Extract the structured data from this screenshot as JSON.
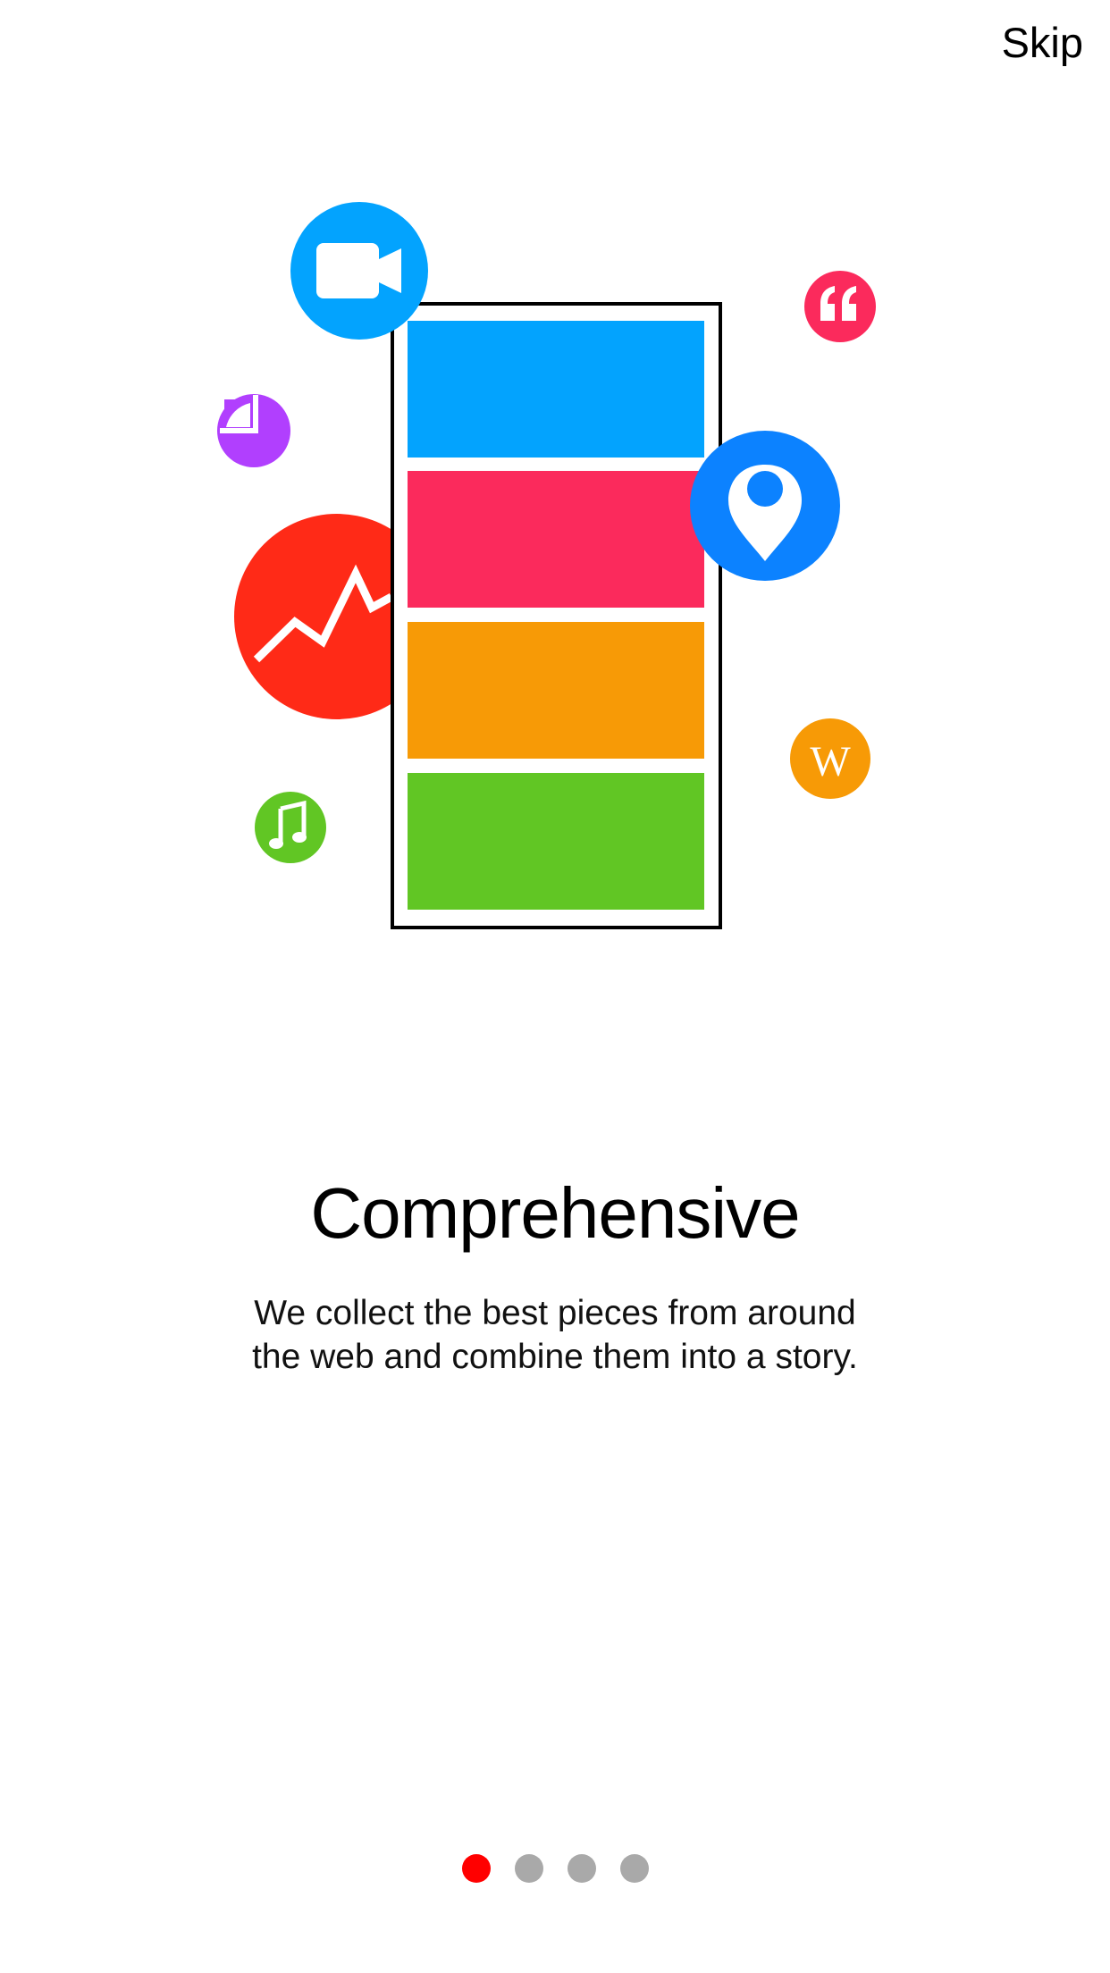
{
  "header": {
    "skip_label": "Skip"
  },
  "page": {
    "title": "Comprehensive",
    "subtitle_line1": "We collect the best pieces from around",
    "subtitle_line2": "the web and combine them into a story."
  },
  "illustration": {
    "icons": [
      "video-camera-icon",
      "quote-icon",
      "pie-chart-icon",
      "location-pin-icon",
      "line-chart-icon",
      "wikipedia-icon",
      "music-note-icon"
    ],
    "wikipedia_glyph": "W",
    "quote_glyph": "“",
    "music_glyph": "♫"
  },
  "pager": {
    "total": 4,
    "active_index": 0
  },
  "colors": {
    "blue": "#03a3fe",
    "pink": "#fb2a5c",
    "orange": "#f79a06",
    "green": "#61c624",
    "red": "#ff2a17",
    "purple": "#b13ffe",
    "pin_blue": "#0c82ff",
    "dot_active": "#ff0000",
    "dot_inactive": "#a9a9a9"
  }
}
